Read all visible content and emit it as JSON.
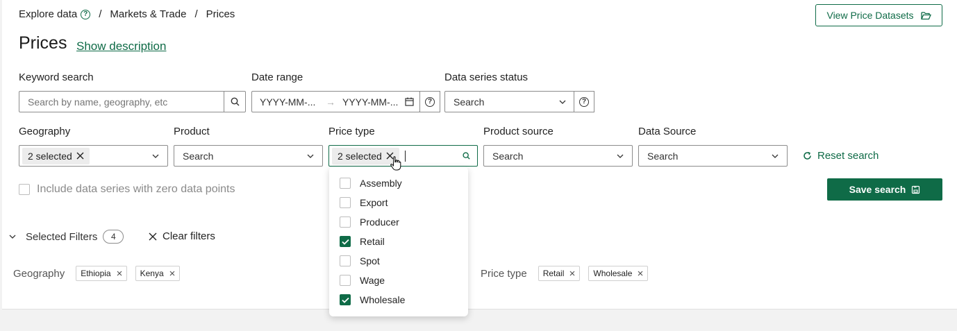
{
  "breadcrumb": {
    "items": [
      "Explore data",
      "Markets & Trade",
      "Prices"
    ],
    "separator": "/"
  },
  "header": {
    "view_datasets_label": "View Price Datasets"
  },
  "page": {
    "title": "Prices",
    "show_description": "Show description"
  },
  "filters": {
    "keyword": {
      "label": "Keyword search",
      "placeholder": "Search by name, geography, etc"
    },
    "date_range": {
      "label": "Date range",
      "start_placeholder": "YYYY-MM-...",
      "end_placeholder": "YYYY-MM-..."
    },
    "status": {
      "label": "Data series status",
      "placeholder": "Search"
    },
    "geography": {
      "label": "Geography",
      "value": "2 selected"
    },
    "product": {
      "label": "Product",
      "placeholder": "Search"
    },
    "price_type": {
      "label": "Price type",
      "value": "2 selected"
    },
    "product_source": {
      "label": "Product source",
      "placeholder": "Search"
    },
    "data_source": {
      "label": "Data Source",
      "placeholder": "Search"
    }
  },
  "actions": {
    "reset": "Reset search",
    "save": "Save search"
  },
  "zero_points_label": "Include data series with zero data points",
  "selected_filters": {
    "label": "Selected Filters",
    "count": "4",
    "clear_label": "Clear filters",
    "groups": [
      {
        "name": "Geography",
        "tags": [
          "Ethiopia",
          "Kenya"
        ]
      },
      {
        "name": "Price type",
        "tags": [
          "Retail",
          "Wholesale"
        ]
      }
    ]
  },
  "price_type_options": [
    {
      "label": "Assembly",
      "checked": false
    },
    {
      "label": "Export",
      "checked": false
    },
    {
      "label": "Producer",
      "checked": false
    },
    {
      "label": "Retail",
      "checked": true
    },
    {
      "label": "Spot",
      "checked": false
    },
    {
      "label": "Wage",
      "checked": false
    },
    {
      "label": "Wholesale",
      "checked": true
    }
  ],
  "colors": {
    "accent": "#0f6b47",
    "border": "#8c8c8c"
  }
}
